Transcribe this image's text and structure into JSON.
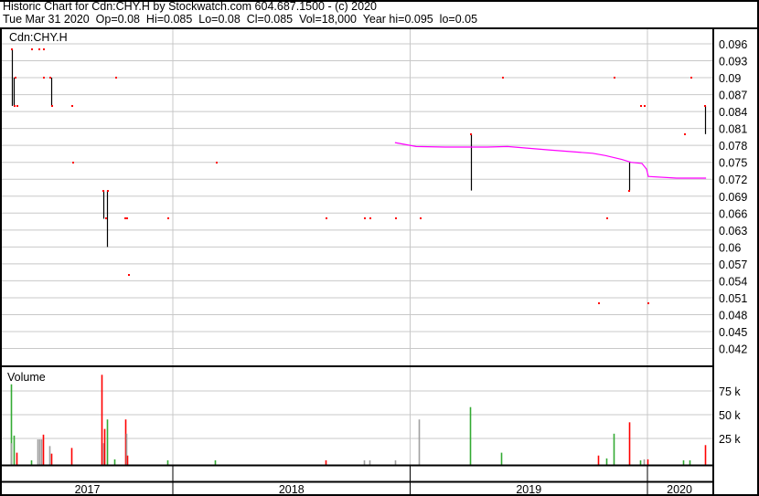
{
  "header": {
    "title": "Historic Chart for Cdn:CHY.H by Stockwatch.com 604.687.1500 - (c) 2020",
    "summary": "Tue Mar 31 2020  Op=0.08  Hi=0.085  Lo=0.08  Cl=0.085  Vol=18,000  Year hi=0.095  lo=0.05"
  },
  "colors": {
    "up": "#33aa33",
    "down": "#ff0000",
    "flat": "#a0a0a0",
    "dot": "#ff0000",
    "range": "#000000",
    "ma": "#ff00ff",
    "grid": "#c8c8c8"
  },
  "chart_data": [
    {
      "type": "line",
      "title": "Cdn:CHY.H",
      "ylim": [
        0.039,
        0.0985
      ],
      "xlim": [
        2017.27,
        2020.27
      ],
      "yticks": [
        "0.096",
        "0.093",
        "0.09",
        "0.087",
        "0.084",
        "0.081",
        "0.078",
        "0.075",
        "0.072",
        "0.069",
        "0.066",
        "0.063",
        "0.06",
        "0.057",
        "0.054",
        "0.051",
        "0.048",
        "0.045",
        "0.042"
      ],
      "ranges": [
        {
          "t": 2017.322,
          "hi": 0.095,
          "lo": 0.085
        },
        {
          "t": 2017.328,
          "hi": 0.09,
          "lo": 0.085
        },
        {
          "t": 2017.487,
          "hi": 0.09,
          "lo": 0.085
        },
        {
          "t": 2017.707,
          "hi": 0.07,
          "lo": 0.065
        },
        {
          "t": 2017.723,
          "hi": 0.07,
          "lo": 0.06
        },
        {
          "t": 2019.256,
          "hi": 0.08,
          "lo": 0.07
        },
        {
          "t": 2019.923,
          "hi": 0.075,
          "lo": 0.07
        },
        {
          "t": 2020.243,
          "hi": 0.085,
          "lo": 0.08
        }
      ],
      "points": [
        {
          "t": 2017.322,
          "p": 0.095
        },
        {
          "t": 2017.333,
          "p": 0.085
        },
        {
          "t": 2017.337,
          "p": 0.09
        },
        {
          "t": 2017.345,
          "p": 0.085
        },
        {
          "t": 2017.407,
          "p": 0.095
        },
        {
          "t": 2017.439,
          "p": 0.095
        },
        {
          "t": 2017.455,
          "p": 0.095
        },
        {
          "t": 2017.457,
          "p": 0.09
        },
        {
          "t": 2017.484,
          "p": 0.09
        },
        {
          "t": 2017.491,
          "p": 0.085
        },
        {
          "t": 2017.576,
          "p": 0.085
        },
        {
          "t": 2017.58,
          "p": 0.075
        },
        {
          "t": 2017.707,
          "p": 0.07
        },
        {
          "t": 2017.719,
          "p": 0.065
        },
        {
          "t": 2017.726,
          "p": 0.07
        },
        {
          "t": 2017.761,
          "p": 0.09
        },
        {
          "t": 2017.8,
          "p": 0.065
        },
        {
          "t": 2017.806,
          "p": 0.065
        },
        {
          "t": 2017.815,
          "p": 0.055
        },
        {
          "t": 2017.981,
          "p": 0.065
        },
        {
          "t": 2018.185,
          "p": 0.075
        },
        {
          "t": 2018.647,
          "p": 0.065
        },
        {
          "t": 2018.809,
          "p": 0.065
        },
        {
          "t": 2018.832,
          "p": 0.065
        },
        {
          "t": 2018.94,
          "p": 0.065
        },
        {
          "t": 2019.044,
          "p": 0.065
        },
        {
          "t": 2019.256,
          "p": 0.08
        },
        {
          "t": 2019.391,
          "p": 0.09
        },
        {
          "t": 2019.796,
          "p": 0.05
        },
        {
          "t": 2019.83,
          "p": 0.065
        },
        {
          "t": 2019.861,
          "p": 0.09
        },
        {
          "t": 2019.923,
          "p": 0.07
        },
        {
          "t": 2019.973,
          "p": 0.085
        },
        {
          "t": 2019.988,
          "p": 0.085
        },
        {
          "t": 2020.004,
          "p": 0.05
        },
        {
          "t": 2020.158,
          "p": 0.08
        },
        {
          "t": 2020.185,
          "p": 0.09
        },
        {
          "t": 2020.243,
          "p": 0.085
        }
      ],
      "moving_average": [
        {
          "t": 2018.936,
          "p": 0.0785
        },
        {
          "t": 2019.025,
          "p": 0.0778
        },
        {
          "t": 2019.148,
          "p": 0.0777
        },
        {
          "t": 2019.325,
          "p": 0.0777
        },
        {
          "t": 2019.41,
          "p": 0.0778
        },
        {
          "t": 2019.584,
          "p": 0.0772
        },
        {
          "t": 2019.769,
          "p": 0.0766
        },
        {
          "t": 2019.823,
          "p": 0.0762
        },
        {
          "t": 2019.892,
          "p": 0.0755
        },
        {
          "t": 2019.931,
          "p": 0.075
        },
        {
          "t": 2019.977,
          "p": 0.0748
        },
        {
          "t": 2019.996,
          "p": 0.0738
        },
        {
          "t": 2020.004,
          "p": 0.0725
        },
        {
          "t": 2020.123,
          "p": 0.0722
        },
        {
          "t": 2020.247,
          "p": 0.0722
        }
      ]
    },
    {
      "type": "bar",
      "title": "Volume",
      "ylim": [
        0,
        100000
      ],
      "yticks": [
        {
          "v": 25000,
          "label": "25 k"
        },
        {
          "v": 50000,
          "label": "50 k"
        },
        {
          "v": 75000,
          "label": "75 k"
        }
      ],
      "bars": [
        {
          "t": 2017.316,
          "v": 82000,
          "c": "up"
        },
        {
          "t": 2017.318,
          "v": 20000,
          "c": "flat"
        },
        {
          "t": 2017.331,
          "v": 28000,
          "c": "up"
        },
        {
          "t": 2017.341,
          "v": 10000,
          "c": "down"
        },
        {
          "t": 2017.403,
          "v": 2000,
          "c": "up"
        },
        {
          "t": 2017.43,
          "v": 24000,
          "c": "flat"
        },
        {
          "t": 2017.437,
          "v": 24000,
          "c": "flat"
        },
        {
          "t": 2017.444,
          "v": 24000,
          "c": "flat"
        },
        {
          "t": 2017.453,
          "v": 29000,
          "c": "down"
        },
        {
          "t": 2017.478,
          "v": 17000,
          "c": "flat"
        },
        {
          "t": 2017.487,
          "v": 9000,
          "c": "down"
        },
        {
          "t": 2017.572,
          "v": 15000,
          "c": "down"
        },
        {
          "t": 2017.699,
          "v": 92000,
          "c": "down"
        },
        {
          "t": 2017.707,
          "v": 20000,
          "c": "flat"
        },
        {
          "t": 2017.711,
          "v": 35000,
          "c": "down"
        },
        {
          "t": 2017.721,
          "v": 45000,
          "c": "up"
        },
        {
          "t": 2017.755,
          "v": 3000,
          "c": "up"
        },
        {
          "t": 2017.8,
          "v": 45000,
          "c": "down"
        },
        {
          "t": 2017.804,
          "v": 30000,
          "c": "flat"
        },
        {
          "t": 2017.807,
          "v": 7000,
          "c": "down"
        },
        {
          "t": 2017.977,
          "v": 2000,
          "c": "up"
        },
        {
          "t": 2018.179,
          "v": 2000,
          "c": "up"
        },
        {
          "t": 2018.644,
          "v": 2000,
          "c": "down"
        },
        {
          "t": 2018.805,
          "v": 2000,
          "c": "flat"
        },
        {
          "t": 2018.829,
          "v": 2000,
          "c": "flat"
        },
        {
          "t": 2018.936,
          "v": 2000,
          "c": "flat"
        },
        {
          "t": 2019.037,
          "v": 45000,
          "c": "flat"
        },
        {
          "t": 2019.252,
          "v": 58000,
          "c": "up"
        },
        {
          "t": 2019.383,
          "v": 10000,
          "c": "up"
        },
        {
          "t": 2019.792,
          "v": 7000,
          "c": "down"
        },
        {
          "t": 2019.827,
          "v": 4000,
          "c": "up"
        },
        {
          "t": 2019.857,
          "v": 30000,
          "c": "up"
        },
        {
          "t": 2019.923,
          "v": 42000,
          "c": "down"
        },
        {
          "t": 2019.969,
          "v": 2000,
          "c": "up"
        },
        {
          "t": 2019.985,
          "v": 3000,
          "c": "flat"
        },
        {
          "t": 2020.0,
          "v": 3000,
          "c": "down"
        },
        {
          "t": 2020.15,
          "v": 2000,
          "c": "up"
        },
        {
          "t": 2020.177,
          "v": 2000,
          "c": "up"
        },
        {
          "t": 2020.243,
          "v": 18000,
          "c": "down"
        }
      ]
    }
  ],
  "years": [
    {
      "label": "2017",
      "start": 2017.27,
      "end": 2018
    },
    {
      "label": "2018",
      "start": 2018,
      "end": 2019
    },
    {
      "label": "2019",
      "start": 2019,
      "end": 2020
    },
    {
      "label": "2020",
      "start": 2020,
      "end": 2020.27
    }
  ]
}
